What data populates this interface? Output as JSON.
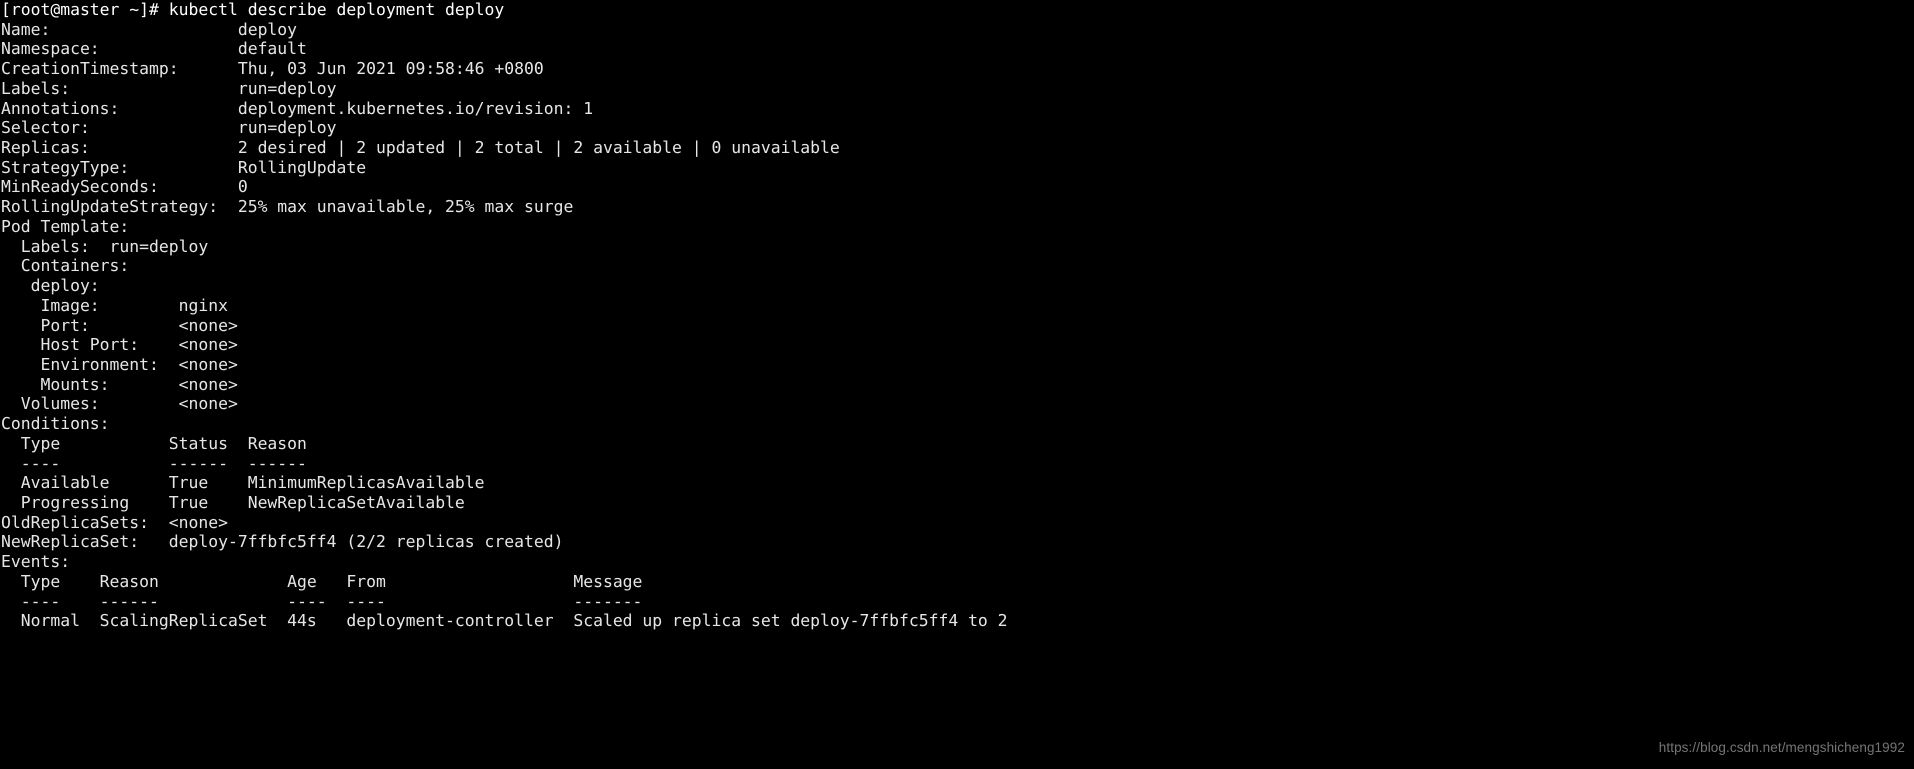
{
  "terminal": {
    "prompt": "[root@master ~]#",
    "command": "kubectl describe deployment deploy",
    "prompt_line": "[root@master ~]# kubectl describe deployment deploy",
    "lines": [
      "[root@master ~]# kubectl describe deployment deploy",
      "Name:                   deploy",
      "Namespace:              default",
      "CreationTimestamp:      Thu, 03 Jun 2021 09:58:46 +0800",
      "Labels:                 run=deploy",
      "Annotations:            deployment.kubernetes.io/revision: 1",
      "Selector:               run=deploy",
      "Replicas:               2 desired | 2 updated | 2 total | 2 available | 0 unavailable",
      "StrategyType:           RollingUpdate",
      "MinReadySeconds:        0",
      "RollingUpdateStrategy:  25% max unavailable, 25% max surge",
      "Pod Template:",
      "  Labels:  run=deploy",
      "  Containers:",
      "   deploy:",
      "    Image:        nginx",
      "    Port:         <none>",
      "    Host Port:    <none>",
      "    Environment:  <none>",
      "    Mounts:       <none>",
      "  Volumes:        <none>",
      "Conditions:",
      "  Type           Status  Reason",
      "  ----           ------  ------",
      "  Available      True    MinimumReplicasAvailable",
      "  Progressing    True    NewReplicaSetAvailable",
      "OldReplicaSets:  <none>",
      "NewReplicaSet:   deploy-7ffbfc5ff4 (2/2 replicas created)",
      "Events:",
      "  Type    Reason             Age   From                   Message",
      "  ----    ------             ----  ----                   -------",
      "  Normal  ScalingReplicaSet  44s   deployment-controller  Scaled up replica set deploy-7ffbfc5ff4 to 2"
    ],
    "fields": {
      "name_label": "Name:",
      "name_value": "deploy",
      "namespace_label": "Namespace:",
      "namespace_value": "default",
      "creation_timestamp_label": "CreationTimestamp:",
      "creation_timestamp_value": "Thu, 03 Jun 2021 09:58:46 +0800",
      "labels_label": "Labels:",
      "labels_value": "run=deploy",
      "annotations_label": "Annotations:",
      "annotations_value": "deployment.kubernetes.io/revision: 1",
      "selector_label": "Selector:",
      "selector_value": "run=deploy",
      "replicas_label": "Replicas:",
      "replicas_value": "2 desired | 2 updated | 2 total | 2 available | 0 unavailable",
      "strategy_type_label": "StrategyType:",
      "strategy_type_value": "RollingUpdate",
      "min_ready_seconds_label": "MinReadySeconds:",
      "min_ready_seconds_value": "0",
      "rolling_update_strategy_label": "RollingUpdateStrategy:",
      "rolling_update_strategy_value": "25% max unavailable, 25% max surge",
      "pod_template_label": "Pod Template:",
      "pod_labels_label": "Labels:",
      "pod_labels_value": "run=deploy",
      "containers_label": "Containers:",
      "container_name": "deploy:",
      "image_label": "Image:",
      "image_value": "nginx",
      "port_label": "Port:",
      "port_value": "<none>",
      "host_port_label": "Host Port:",
      "host_port_value": "<none>",
      "environment_label": "Environment:",
      "environment_value": "<none>",
      "mounts_label": "Mounts:",
      "mounts_value": "<none>",
      "volumes_label": "Volumes:",
      "volumes_value": "<none>",
      "conditions_label": "Conditions:",
      "old_replicasets_label": "OldReplicaSets:",
      "old_replicasets_value": "<none>",
      "new_replicaset_label": "NewReplicaSet:",
      "new_replicaset_value": "deploy-7ffbfc5ff4 (2/2 replicas created)",
      "events_label": "Events:"
    },
    "conditions_table": {
      "headers": [
        "Type",
        "Status",
        "Reason"
      ],
      "separators": [
        "----",
        "------",
        "------"
      ],
      "rows": [
        [
          "Available",
          "True",
          "MinimumReplicasAvailable"
        ],
        [
          "Progressing",
          "True",
          "NewReplicaSetAvailable"
        ]
      ]
    },
    "events_table": {
      "headers": [
        "Type",
        "Reason",
        "Age",
        "From",
        "Message"
      ],
      "separators": [
        "----",
        "------",
        "----",
        "----",
        "-------"
      ],
      "rows": [
        [
          "Normal",
          "ScalingReplicaSet",
          "44s",
          "deployment-controller",
          "Scaled up replica set deploy-7ffbfc5ff4 to 2"
        ]
      ]
    },
    "colors": {
      "background": "#000000",
      "foreground": "#e6e6e6",
      "watermark": "#8a8a8a"
    }
  },
  "watermark": {
    "text": "https://blog.csdn.net/mengshicheng1992"
  }
}
